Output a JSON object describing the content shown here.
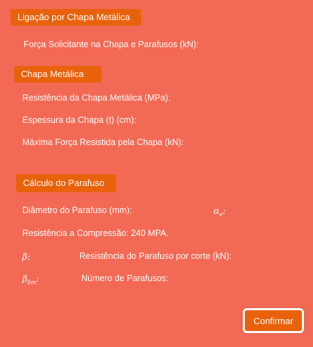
{
  "sections": {
    "chapa_ligacao": {
      "title": "Ligação por Chapa Metálica",
      "forca_label": "Força Solicitante na Chapa e Parafusos (kN):"
    },
    "chapa_metalica": {
      "title": "Chapa Metálica",
      "resistencia_label": "Resistência da Chapa Metálica (MPa):",
      "espessura_label": "Espessura da Chapa (t) (cm):",
      "maxima_forca_label": "Máxima Força Resistida pela Chapa (kN):"
    },
    "parafuso": {
      "title": "Cálculo do Parafuso",
      "diametro_label": "Diâmetro do Parafuso (mm):",
      "alpha_symbol": "α",
      "alpha_sub": "e",
      "alpha_suffix": ":",
      "compressao_label": "Resistência a Compressão: 240 MPA.",
      "beta_symbol": "β:",
      "resistencia_corte_label": "Resistência do Parafuso por corte (kN):",
      "beta_lim_symbol": "β",
      "beta_lim_sub": "lim",
      "beta_lim_suffix": ":",
      "numero_label": "Número de Parafusos:"
    }
  },
  "actions": {
    "confirm_label": "Confirmar"
  },
  "colors": {
    "background": "#f26a55",
    "header": "#e8620c",
    "text": "#ffffff"
  }
}
